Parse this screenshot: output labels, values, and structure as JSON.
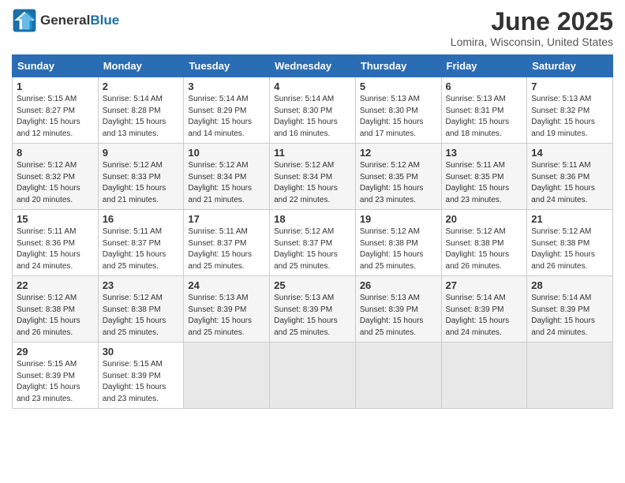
{
  "header": {
    "logo_general": "General",
    "logo_blue": "Blue",
    "month": "June 2025",
    "location": "Lomira, Wisconsin, United States"
  },
  "weekdays": [
    "Sunday",
    "Monday",
    "Tuesday",
    "Wednesday",
    "Thursday",
    "Friday",
    "Saturday"
  ],
  "weeks": [
    [
      {
        "day": "1",
        "info": "Sunrise: 5:15 AM\nSunset: 8:27 PM\nDaylight: 15 hours\nand 12 minutes."
      },
      {
        "day": "2",
        "info": "Sunrise: 5:14 AM\nSunset: 8:28 PM\nDaylight: 15 hours\nand 13 minutes."
      },
      {
        "day": "3",
        "info": "Sunrise: 5:14 AM\nSunset: 8:29 PM\nDaylight: 15 hours\nand 14 minutes."
      },
      {
        "day": "4",
        "info": "Sunrise: 5:14 AM\nSunset: 8:30 PM\nDaylight: 15 hours\nand 16 minutes."
      },
      {
        "day": "5",
        "info": "Sunrise: 5:13 AM\nSunset: 8:30 PM\nDaylight: 15 hours\nand 17 minutes."
      },
      {
        "day": "6",
        "info": "Sunrise: 5:13 AM\nSunset: 8:31 PM\nDaylight: 15 hours\nand 18 minutes."
      },
      {
        "day": "7",
        "info": "Sunrise: 5:13 AM\nSunset: 8:32 PM\nDaylight: 15 hours\nand 19 minutes."
      }
    ],
    [
      {
        "day": "8",
        "info": "Sunrise: 5:12 AM\nSunset: 8:32 PM\nDaylight: 15 hours\nand 20 minutes."
      },
      {
        "day": "9",
        "info": "Sunrise: 5:12 AM\nSunset: 8:33 PM\nDaylight: 15 hours\nand 21 minutes."
      },
      {
        "day": "10",
        "info": "Sunrise: 5:12 AM\nSunset: 8:34 PM\nDaylight: 15 hours\nand 21 minutes."
      },
      {
        "day": "11",
        "info": "Sunrise: 5:12 AM\nSunset: 8:34 PM\nDaylight: 15 hours\nand 22 minutes."
      },
      {
        "day": "12",
        "info": "Sunrise: 5:12 AM\nSunset: 8:35 PM\nDaylight: 15 hours\nand 23 minutes."
      },
      {
        "day": "13",
        "info": "Sunrise: 5:11 AM\nSunset: 8:35 PM\nDaylight: 15 hours\nand 23 minutes."
      },
      {
        "day": "14",
        "info": "Sunrise: 5:11 AM\nSunset: 8:36 PM\nDaylight: 15 hours\nand 24 minutes."
      }
    ],
    [
      {
        "day": "15",
        "info": "Sunrise: 5:11 AM\nSunset: 8:36 PM\nDaylight: 15 hours\nand 24 minutes."
      },
      {
        "day": "16",
        "info": "Sunrise: 5:11 AM\nSunset: 8:37 PM\nDaylight: 15 hours\nand 25 minutes."
      },
      {
        "day": "17",
        "info": "Sunrise: 5:11 AM\nSunset: 8:37 PM\nDaylight: 15 hours\nand 25 minutes."
      },
      {
        "day": "18",
        "info": "Sunrise: 5:12 AM\nSunset: 8:37 PM\nDaylight: 15 hours\nand 25 minutes."
      },
      {
        "day": "19",
        "info": "Sunrise: 5:12 AM\nSunset: 8:38 PM\nDaylight: 15 hours\nand 25 minutes."
      },
      {
        "day": "20",
        "info": "Sunrise: 5:12 AM\nSunset: 8:38 PM\nDaylight: 15 hours\nand 26 minutes."
      },
      {
        "day": "21",
        "info": "Sunrise: 5:12 AM\nSunset: 8:38 PM\nDaylight: 15 hours\nand 26 minutes."
      }
    ],
    [
      {
        "day": "22",
        "info": "Sunrise: 5:12 AM\nSunset: 8:38 PM\nDaylight: 15 hours\nand 26 minutes."
      },
      {
        "day": "23",
        "info": "Sunrise: 5:12 AM\nSunset: 8:38 PM\nDaylight: 15 hours\nand 25 minutes."
      },
      {
        "day": "24",
        "info": "Sunrise: 5:13 AM\nSunset: 8:39 PM\nDaylight: 15 hours\nand 25 minutes."
      },
      {
        "day": "25",
        "info": "Sunrise: 5:13 AM\nSunset: 8:39 PM\nDaylight: 15 hours\nand 25 minutes."
      },
      {
        "day": "26",
        "info": "Sunrise: 5:13 AM\nSunset: 8:39 PM\nDaylight: 15 hours\nand 25 minutes."
      },
      {
        "day": "27",
        "info": "Sunrise: 5:14 AM\nSunset: 8:39 PM\nDaylight: 15 hours\nand 24 minutes."
      },
      {
        "day": "28",
        "info": "Sunrise: 5:14 AM\nSunset: 8:39 PM\nDaylight: 15 hours\nand 24 minutes."
      }
    ],
    [
      {
        "day": "29",
        "info": "Sunrise: 5:15 AM\nSunset: 8:39 PM\nDaylight: 15 hours\nand 23 minutes."
      },
      {
        "day": "30",
        "info": "Sunrise: 5:15 AM\nSunset: 8:39 PM\nDaylight: 15 hours\nand 23 minutes."
      },
      {
        "day": "",
        "info": ""
      },
      {
        "day": "",
        "info": ""
      },
      {
        "day": "",
        "info": ""
      },
      {
        "day": "",
        "info": ""
      },
      {
        "day": "",
        "info": ""
      }
    ]
  ]
}
